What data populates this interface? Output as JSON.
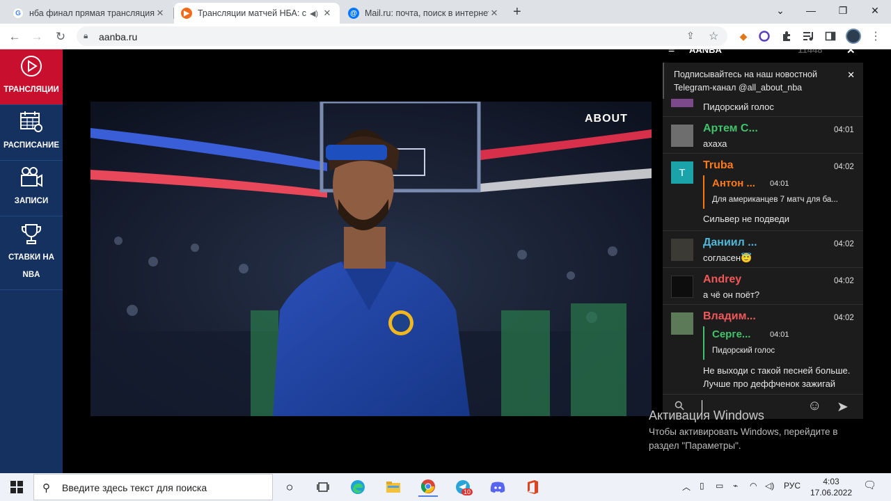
{
  "browser": {
    "tabs": [
      {
        "title": "нба финал прямая трансляция",
        "active": false
      },
      {
        "title": "Трансляции матчей НБА: се",
        "active": true
      },
      {
        "title": "Mail.ru: почта, поиск в интернете",
        "active": false
      }
    ],
    "new_tab": "+",
    "url": "aanba.ru"
  },
  "sidebar": {
    "items": [
      {
        "label": "ТРАНСЛЯЦИИ",
        "icon": "play-circle-icon",
        "active": true
      },
      {
        "label": "РАСПИСАНИЕ",
        "icon": "calendar-icon",
        "active": false
      },
      {
        "label": "ЗАПИСИ",
        "icon": "video-camera-icon",
        "active": false
      },
      {
        "label": "СТАВКИ НА",
        "label2": "NBA",
        "icon": "trophy-icon",
        "active": false
      }
    ]
  },
  "video": {
    "logo": "ABOUT"
  },
  "chat": {
    "header_title": "AANBA",
    "online_count": "11448",
    "telegram_notice": "Подписывайтесь на наш новостной Telegram-канал @all_about_nba",
    "messages": [
      {
        "name": "",
        "time": "",
        "text": "Пидорский голос",
        "name_color": "#3fc56b"
      },
      {
        "name": "Артем С...",
        "time": "04:01",
        "text": "ахаха",
        "name_color": "#3fc56b"
      },
      {
        "name": "Truba",
        "time": "04:02",
        "avatar_letter": "T",
        "reply_name": "Антон ...",
        "reply_time": "04:01",
        "reply_text": "Для американцев 7 матч для ба...",
        "text": "Сильвер не подведи",
        "name_color": "#ff7a1a"
      },
      {
        "name": "Даниил ...",
        "time": "04:02",
        "text": "согласен😇",
        "name_color": "#4fb7d9"
      },
      {
        "name": "Andrey",
        "time": "04:02",
        "text": "а чё он поёт?",
        "name_color": "#f2585a"
      },
      {
        "name": "Владим...",
        "time": "04:02",
        "reply_name": "Серге...",
        "reply_time": "04:01",
        "reply_text": "Пидорский голос",
        "text": "Не выходи с такой песней больше.",
        "text2": "Лучше про деффченок зажигай",
        "name_color": "#f2585a"
      }
    ]
  },
  "windows_activation": {
    "title": "Активация Windows",
    "line1": "Чтобы активировать Windows, перейдите в",
    "line2": "раздел \"Параметры\"."
  },
  "taskbar": {
    "search_placeholder": "Введите здесь текст для поиска",
    "lang": "РУС",
    "time": "4:03",
    "date": "17.06.2022",
    "telegram_badge": "10"
  }
}
